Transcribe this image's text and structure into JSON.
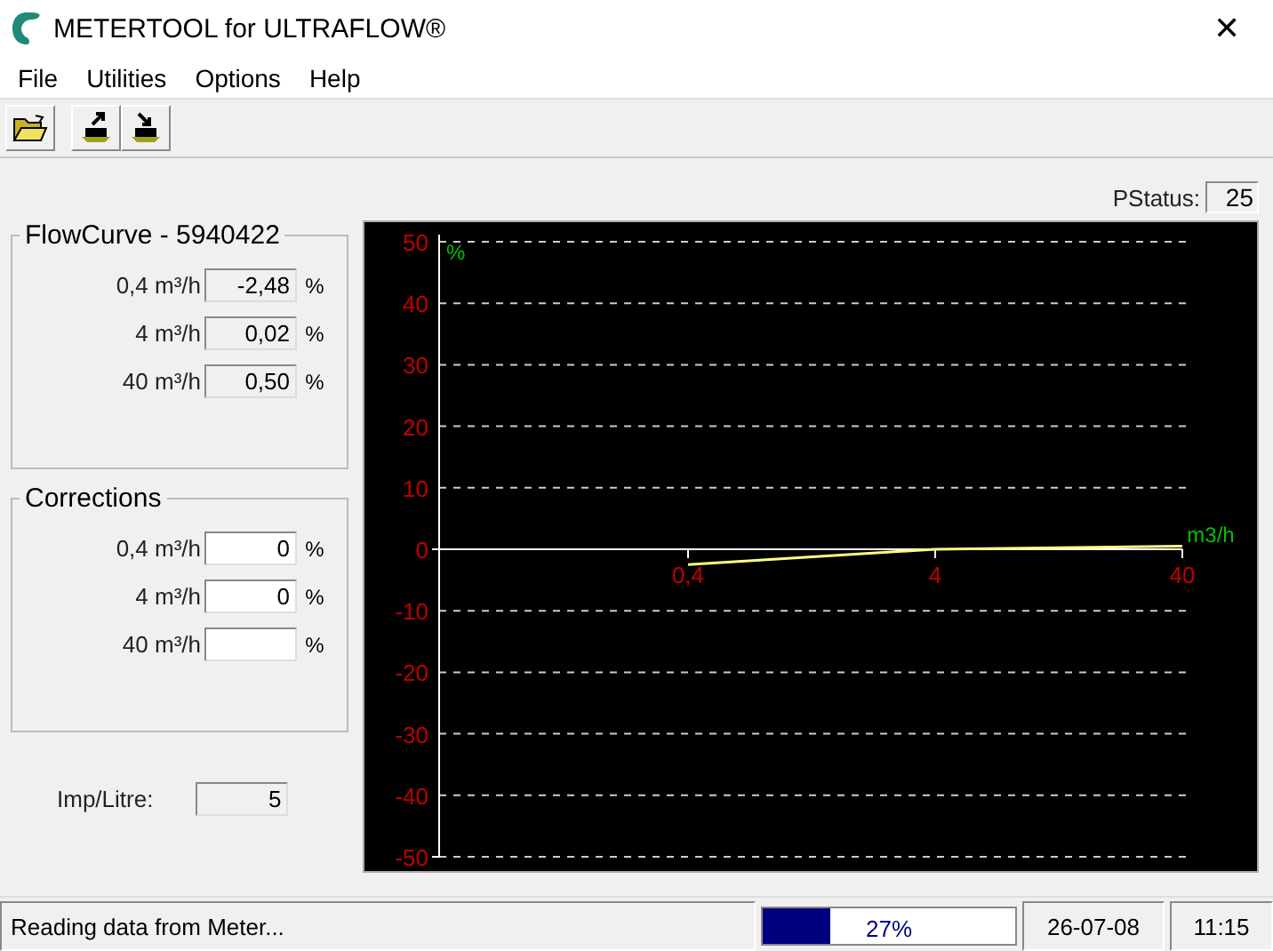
{
  "window": {
    "title": "METERTOOL for ULTRAFLOW®",
    "close": "✕"
  },
  "menu": [
    "File",
    "Utilities",
    "Options",
    "Help"
  ],
  "pstatus": {
    "label": "PStatus:",
    "value": "25"
  },
  "flowcurve": {
    "title": "FlowCurve - 5940422",
    "rows": [
      {
        "label": "0,4 m³/h",
        "value": "-2,48",
        "unit": "%"
      },
      {
        "label": "4 m³/h",
        "value": "0,02",
        "unit": "%"
      },
      {
        "label": "40 m³/h",
        "value": "0,50",
        "unit": "%"
      }
    ]
  },
  "corrections": {
    "title": "Corrections",
    "rows": [
      {
        "label": "0,4 m³/h",
        "value": "0",
        "unit": "%"
      },
      {
        "label": "4 m³/h",
        "value": "0",
        "unit": "%"
      },
      {
        "label": "40 m³/h",
        "value": "",
        "unit": "%"
      }
    ]
  },
  "imp_litre": {
    "label": "Imp/Litre:",
    "value": "5"
  },
  "chart_data": {
    "type": "line",
    "xlabel": "m3/h",
    "ylabel": "%",
    "categories": [
      "0,4",
      "4",
      "40"
    ],
    "series": [
      {
        "color": "#ffff80",
        "values": [
          -2.5,
          0,
          0.5
        ]
      }
    ],
    "grid": true,
    "ylim": [
      -50,
      50
    ],
    "yticks": [
      -50,
      -40,
      -30,
      -20,
      -10,
      0,
      10,
      20,
      30,
      40,
      50
    ]
  },
  "status_bar": {
    "message": "Reading data from Meter...",
    "progress": {
      "level": 0.27,
      "label": "27%"
    },
    "date": "26-07-08",
    "time": "11:15"
  }
}
